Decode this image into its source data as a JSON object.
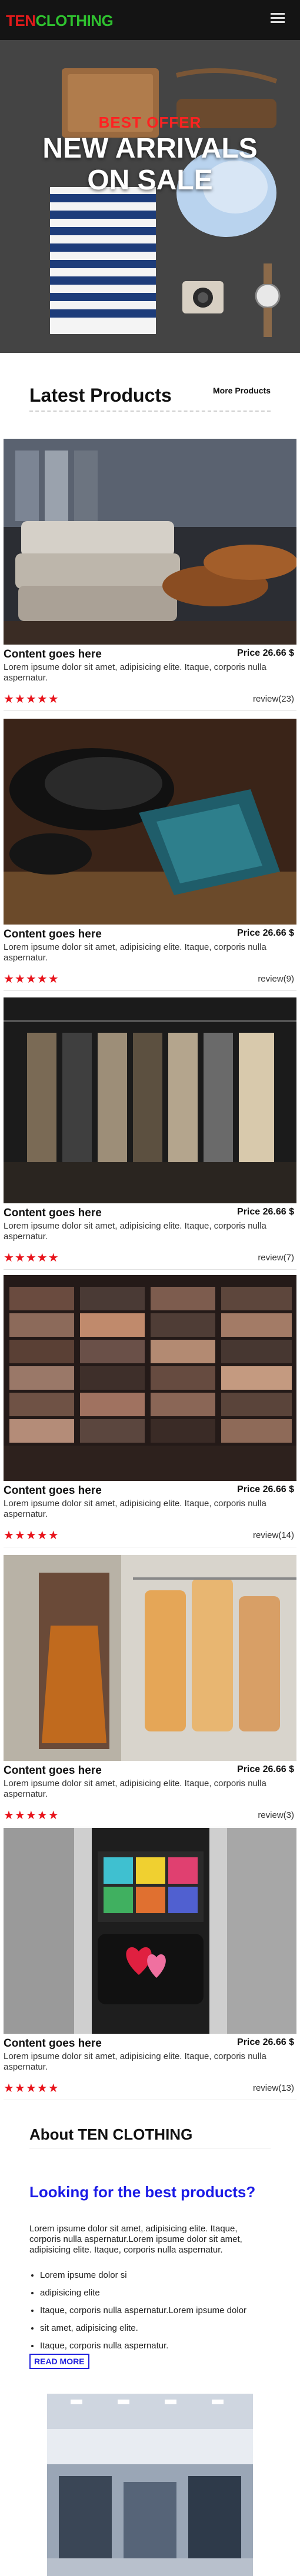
{
  "brand": {
    "part1": "TEN",
    "part2": "CLOTHING"
  },
  "nav": {
    "menu_icon": "hamburger-menu-icon"
  },
  "hero": {
    "eyebrow": "BEST OFFER",
    "title": "NEW ARRIVALS ON SALE"
  },
  "latest": {
    "title": "Latest Products",
    "more_label": "More Products"
  },
  "products": [
    {
      "name": "Content goes here",
      "price": "Price 26.66 $",
      "description": "Lorem ipsume dolor sit amet, adipisicing elite. Itaque, corporis nulla aspernatur.",
      "stars": "★★★★★",
      "review": "review(23)"
    },
    {
      "name": "Content goes here",
      "price": "Price 26.66 $",
      "description": "Lorem ipsume dolor sit amet, adipisicing elite. Itaque, corporis nulla aspernatur.",
      "stars": "★★★★★",
      "review": "review(9)"
    },
    {
      "name": "Content goes here",
      "price": "Price 26.66 $",
      "description": "Lorem ipsume dolor sit amet, adipisicing elite. Itaque, corporis nulla aspernatur.",
      "stars": "★★★★★",
      "review": "review(7)"
    },
    {
      "name": "Content goes here",
      "price": "Price 26.66 $",
      "description": "Lorem ipsume dolor sit amet, adipisicing elite. Itaque, corporis nulla aspernatur.",
      "stars": "★★★★★",
      "review": "review(14)"
    },
    {
      "name": "Content goes here",
      "price": "Price 26.66 $",
      "description": "Lorem ipsume dolor sit amet, adipisicing elite. Itaque, corporis nulla aspernatur.",
      "stars": "★★★★★",
      "review": "review(3)"
    },
    {
      "name": "Content goes here",
      "price": "Price 26.66 $",
      "description": "Lorem ipsume dolor sit amet, adipisicing elite. Itaque, corporis nulla aspernatur.",
      "stars": "★★★★★",
      "review": "review(13)"
    }
  ],
  "about": {
    "title": "About TEN CLOTHING",
    "subtitle": "Looking for the best products?",
    "paragraph": "Lorem ipsume dolor sit amet, adipisicing elite. Itaque, corporis nulla aspernatur.Lorem ipsume dolor sit amet, adipisicing elite. Itaque, corporis nulla aspernatur.",
    "list": [
      "Lorem ipsume dolor si",
      "adipisicing elite",
      "Itaque, corporis nulla aspernatur.Lorem ipsume dolor",
      "sit amet, adipisicing elite.",
      "Itaque, corporis nulla aspernatur."
    ],
    "button_label": "READ MORE"
  },
  "colors": {
    "brand_red": "#e01b1b",
    "brand_green": "#2fc12f",
    "star_red": "#e8141c",
    "link_blue": "#1a1ae6",
    "header_bg": "#141414"
  }
}
